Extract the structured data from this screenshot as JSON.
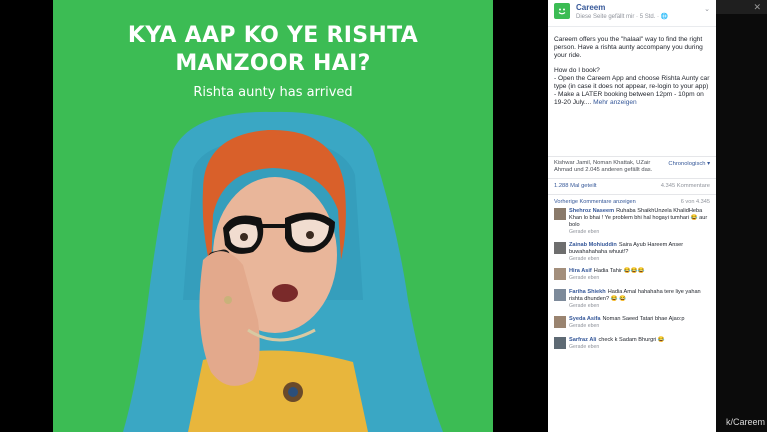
{
  "ad": {
    "headline_line1": "KYA AAP KO YE RISHTA",
    "headline_line2": "MANZOOR HAI?",
    "subtitle": "Rishta aunty has arrived"
  },
  "post": {
    "page_name": "Careem",
    "meta": "Diese Seite gefällt mir · 5 Std. · 🌐",
    "para1": "Careem offers you the \"halaal\" way to find the right person. Have a rishta aunty accompany you during your ride.",
    "para2_title": "How do I book?",
    "para2_line1": "- Open the Careem App and choose Rishta Aunty car type (in case it does not appear, re-login to your app)",
    "para2_line2": "- Make a LATER booking between 12pm - 10pm on 19-20 July....",
    "more": "Mehr anzeigen",
    "likes_text": "Kishwar Jamil, Noman Khattak, UZair Ahmad und 2.045 anderen gefällt das.",
    "sort_label": "Chronologisch ▾",
    "shares": "1.288 Mal geteilt",
    "comments_count": "4.345 Kommentare",
    "prev_comments": "Vorherige Kommentare anzeigen",
    "comment_counter": "6 von 4.345"
  },
  "comments": [
    {
      "name": "Shehroz Naseem",
      "text": "Ruhaba ShaikhUnzela KhalidHeba Khan lo bhai ! Ye problem bhi hal hogayi tumhari 😂 aur bolo",
      "time": "Gerade eben"
    },
    {
      "name": "Zainab Mohiuddin",
      "text": "Saira Ayub Hareem Anser buwahahahaha whuut!?",
      "time": "Gerade eben"
    },
    {
      "name": "Hira Asif",
      "text": "Hadia Tahir 😂😂😂",
      "time": "Gerade eben"
    },
    {
      "name": "Fariha Shiekh",
      "text": "Hadia Amal hahahaha tere liye yahan rishta dhunden? 😂 😂",
      "time": "Gerade eben"
    },
    {
      "name": "Syeda Asifa",
      "text": "Noman Saeed Tatari bhae Ajao:p",
      "time": "Gerade eben"
    },
    {
      "name": "Sarfraz Ali",
      "text": "check k Sadam Bhurgri 😂",
      "time": "Gerade eben"
    }
  ],
  "window": {
    "close_glyph": "✕",
    "credit": "k/Careem"
  },
  "colors": {
    "brand_green": "#3cbc54",
    "scarf": "#3aa7c4",
    "hair": "#d9602a",
    "link": "#365899"
  }
}
